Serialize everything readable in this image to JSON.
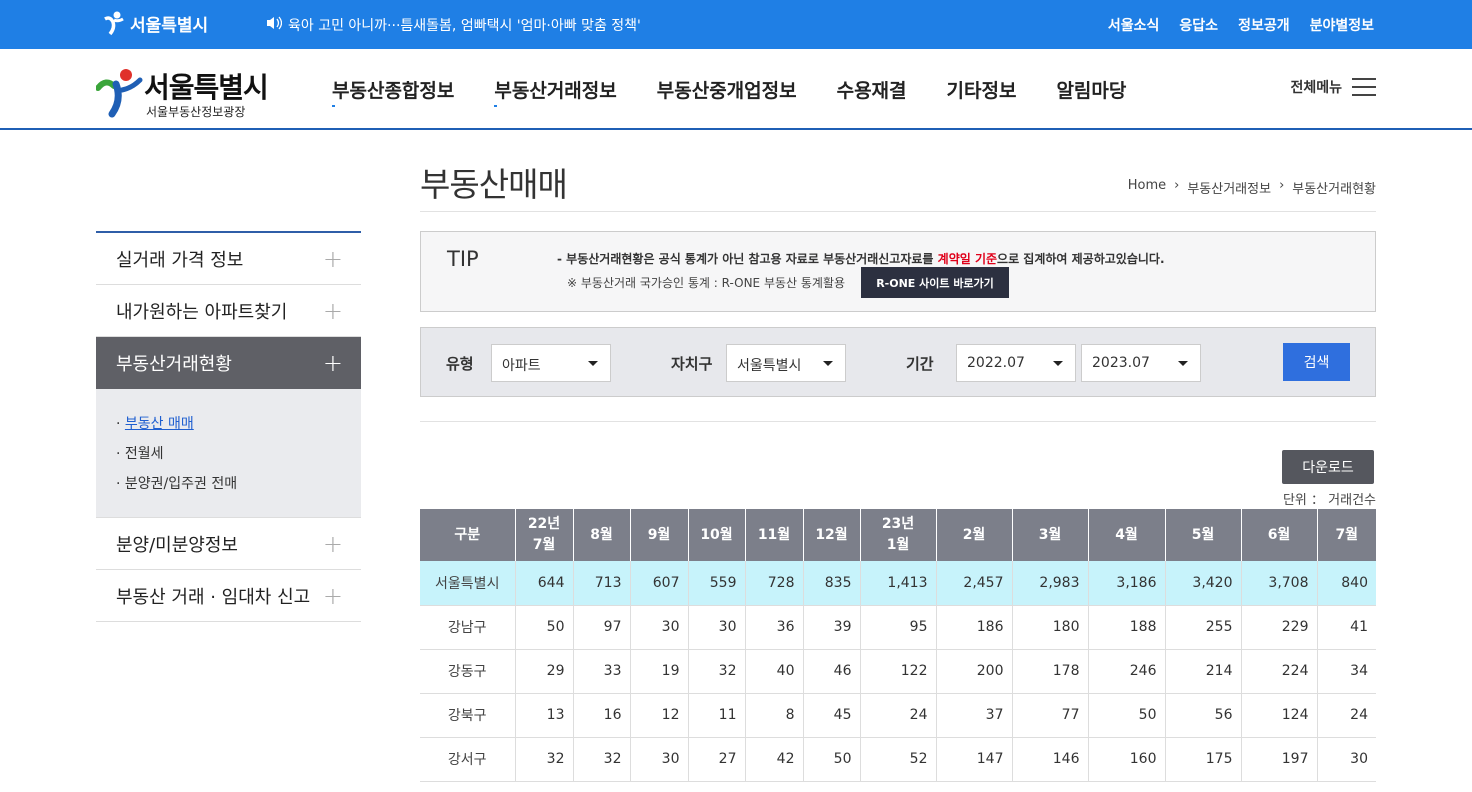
{
  "topbar": {
    "logo": "서울특별시",
    "notice": "육아 고민 아니까···틈새돌봄, 엄빠택시 '엄마·아빠 맞춤 정책'",
    "util_links": [
      "서울소식",
      "응답소",
      "정보공개",
      "분야별정보"
    ]
  },
  "header": {
    "logo_title": "서울특별시",
    "logo_sub": "서울부동산정보광장",
    "nav": [
      "부동산종합정보",
      "부동산거래정보",
      "부동산중개업정보",
      "수용재결",
      "기타정보",
      "알림마당"
    ],
    "all_menu": "전체메뉴"
  },
  "sidebar": {
    "items": [
      {
        "label": "실거래 가격 정보"
      },
      {
        "label": "내가원하는 아파트찾기"
      },
      {
        "label": "부동산거래현황"
      },
      {
        "label": "분양/미분양정보"
      },
      {
        "label": "부동산 거래 · 임대차 신고"
      }
    ],
    "sub_items": [
      "부동산 매매",
      "전월세",
      "분양권/입주권 전매"
    ]
  },
  "page": {
    "title": "부동산매매",
    "breadcrumb": [
      "Home",
      "부동산거래정보",
      "부동산거래현황"
    ]
  },
  "tip": {
    "label": "TIP",
    "line1_prefix": "-  부동산거래현황은 공식 통계가 아닌 참고용 자료로 부동산거래신고자료를 ",
    "line1_highlight": "계약일 기준",
    "line1_suffix": "으로 집계하여 제공하고있습니다.",
    "line2": "※ 부동산거래 국가승인 통계 : R-ONE 부동산 통계활용",
    "rone_button": "R-ONE 사이트 바로가기"
  },
  "search": {
    "type_label": "유형",
    "type_value": "아파트",
    "district_label": "자치구",
    "district_value": "서울특별시",
    "period_label": "기간",
    "period_from": "2022.07",
    "period_to": "2023.07",
    "search_button": "검색"
  },
  "download_button": "다운로드",
  "unit_text": "단위  ：  거래건수",
  "table": {
    "headers": [
      "구분",
      "22년\n7월",
      "8월",
      "9월",
      "10월",
      "11월",
      "12월",
      "23년\n1월",
      "2월",
      "3월",
      "4월",
      "5월",
      "6월",
      "7월"
    ],
    "rows": [
      [
        "서울특별시",
        "644",
        "713",
        "607",
        "559",
        "728",
        "835",
        "1,413",
        "2,457",
        "2,983",
        "3,186",
        "3,420",
        "3,708",
        "840"
      ],
      [
        "강남구",
        "50",
        "97",
        "30",
        "30",
        "36",
        "39",
        "95",
        "186",
        "180",
        "188",
        "255",
        "229",
        "41"
      ],
      [
        "강동구",
        "29",
        "33",
        "19",
        "32",
        "40",
        "46",
        "122",
        "200",
        "178",
        "246",
        "214",
        "224",
        "34"
      ],
      [
        "강북구",
        "13",
        "16",
        "12",
        "11",
        "8",
        "45",
        "24",
        "37",
        "77",
        "50",
        "56",
        "124",
        "24"
      ],
      [
        "강서구",
        "32",
        "32",
        "30",
        "27",
        "42",
        "50",
        "52",
        "147",
        "146",
        "160",
        "175",
        "197",
        "30"
      ]
    ]
  }
}
